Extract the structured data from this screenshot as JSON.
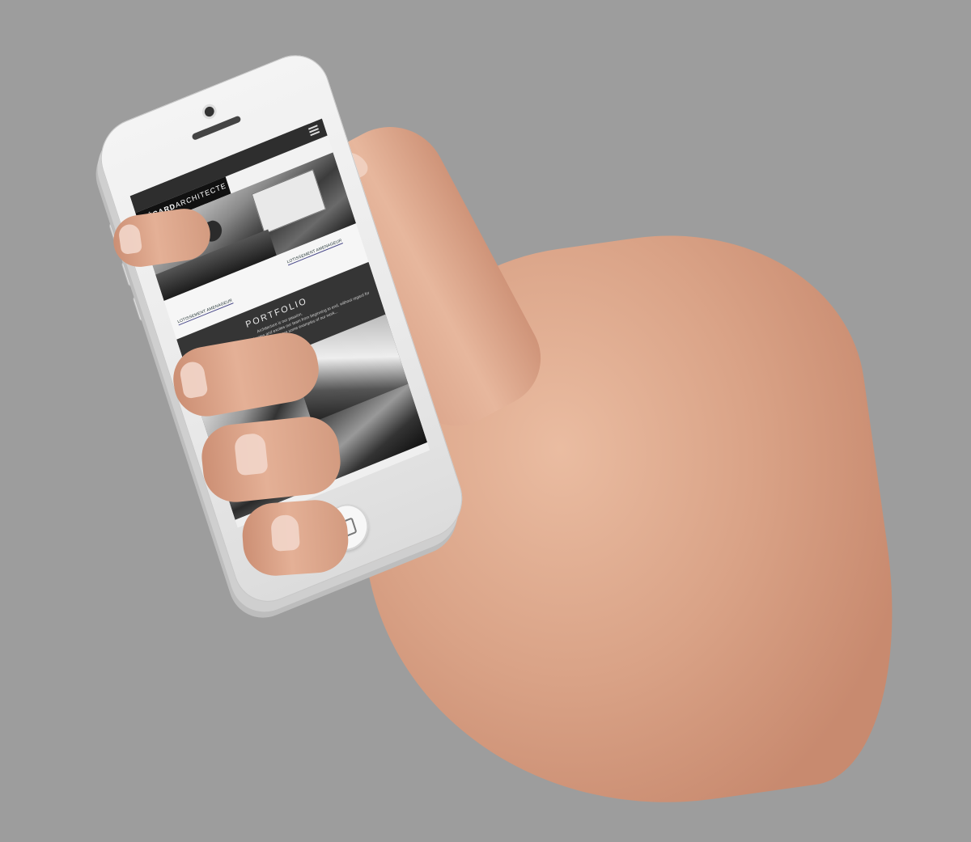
{
  "screen": {
    "logo_bold": "PÉCARD",
    "logo_light": "ARCHITECTE",
    "partner_logo_left": "LOTISSEMENT AMENAGEUR",
    "partner_logo_right": "LOTISSEMENT AMENAGEUR",
    "portfolio_title": "PORTFOLIO",
    "portfolio_text_1": "Architecture is our passion.",
    "portfolio_text_2": "Each project is an adventure that animates and excites our team from beginning to end, without regard for the project size or budget. Here are some examples of our work..."
  },
  "icons": [
    "menu-icon",
    "home-button-icon"
  ],
  "colors": {
    "background": "#9d9d9d",
    "phone_body": "#f0f0f0",
    "site_dark": "#353535",
    "skin": "#e0ac92"
  }
}
